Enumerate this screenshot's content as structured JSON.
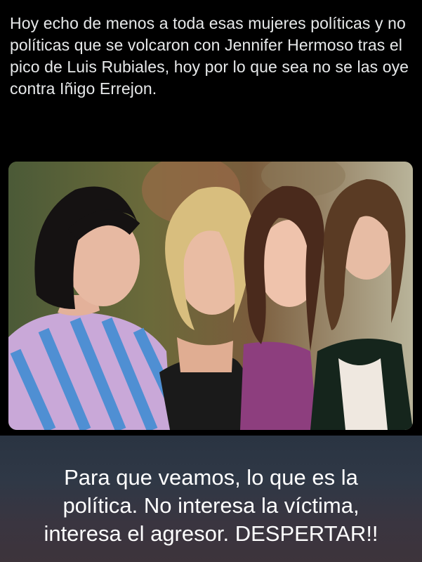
{
  "post": {
    "text": "Hoy echo de menos a toda esas mujeres políticas y no políticas que se volcaron con Jennifer Hermoso tras el pico de Luis Rubiales, hoy por lo que sea no se las oye contra Iñigo Errejon."
  },
  "photo": {
    "icon": "photo-four-women-seated"
  },
  "caption": {
    "line1": "Para que veamos, lo que es la",
    "line2": "política. No interesa la víctima,",
    "line3": "interesa el agresor. DESPERTAR!!"
  },
  "colors": {
    "background": "#000000",
    "post_text": "#e7e9ea",
    "caption_text": "#ffffff"
  }
}
